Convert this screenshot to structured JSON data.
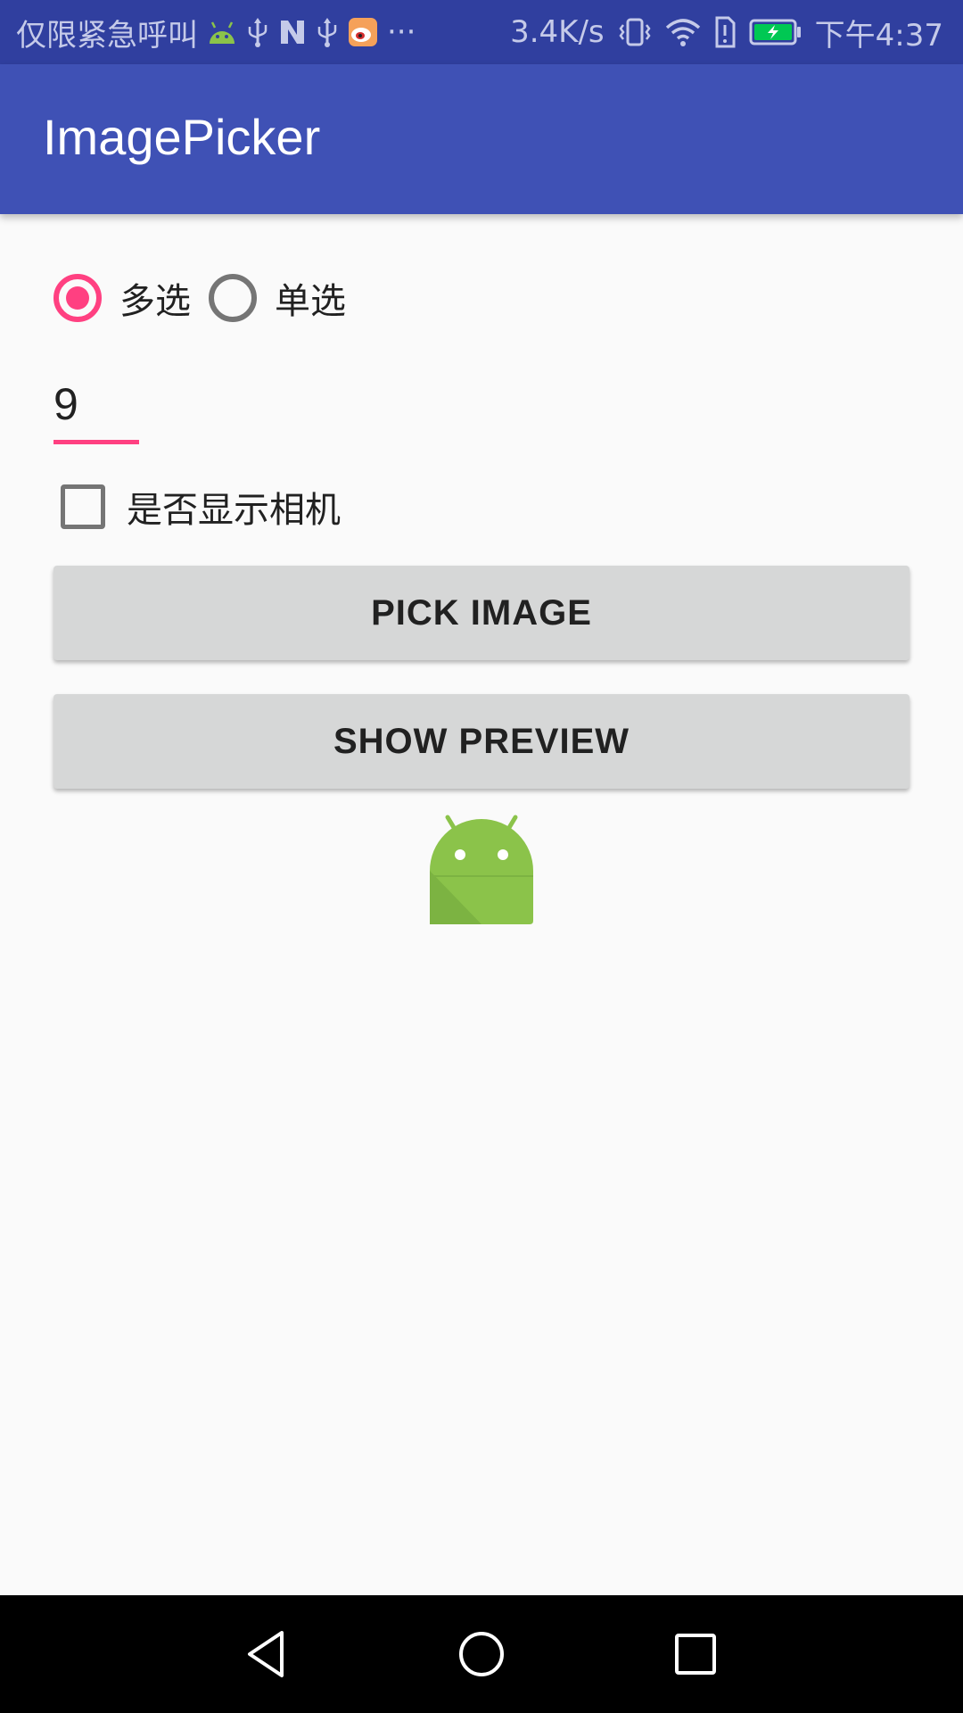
{
  "status_bar": {
    "carrier_text": "仅限紧急呼叫",
    "more_indicator": "···",
    "network_speed": "3.4K/s",
    "time": "下午4:37",
    "icons": [
      "android-icon",
      "usb-icon",
      "n-icon",
      "usb-icon",
      "weibo-icon",
      "vibrate-icon",
      "wifi-icon",
      "sim-alert-icon",
      "battery-charging-icon"
    ],
    "battery_color": "#00c853"
  },
  "app_bar": {
    "title": "ImagePicker",
    "color": "#3f51b5"
  },
  "selection_mode": {
    "options": [
      {
        "label": "多选",
        "checked": true
      },
      {
        "label": "单选",
        "checked": false
      }
    ],
    "accent_color": "#ff4081"
  },
  "count_field": {
    "value": "9"
  },
  "show_camera": {
    "label": "是否显示相机",
    "checked": false
  },
  "buttons": {
    "pick_image": "PICK IMAGE",
    "show_preview": "SHOW PREVIEW"
  },
  "preview_image": {
    "icon": "android-robot-icon",
    "color": "#8bc34a"
  },
  "nav_bar": {
    "icons": [
      "back-icon",
      "home-icon",
      "recents-icon"
    ]
  }
}
